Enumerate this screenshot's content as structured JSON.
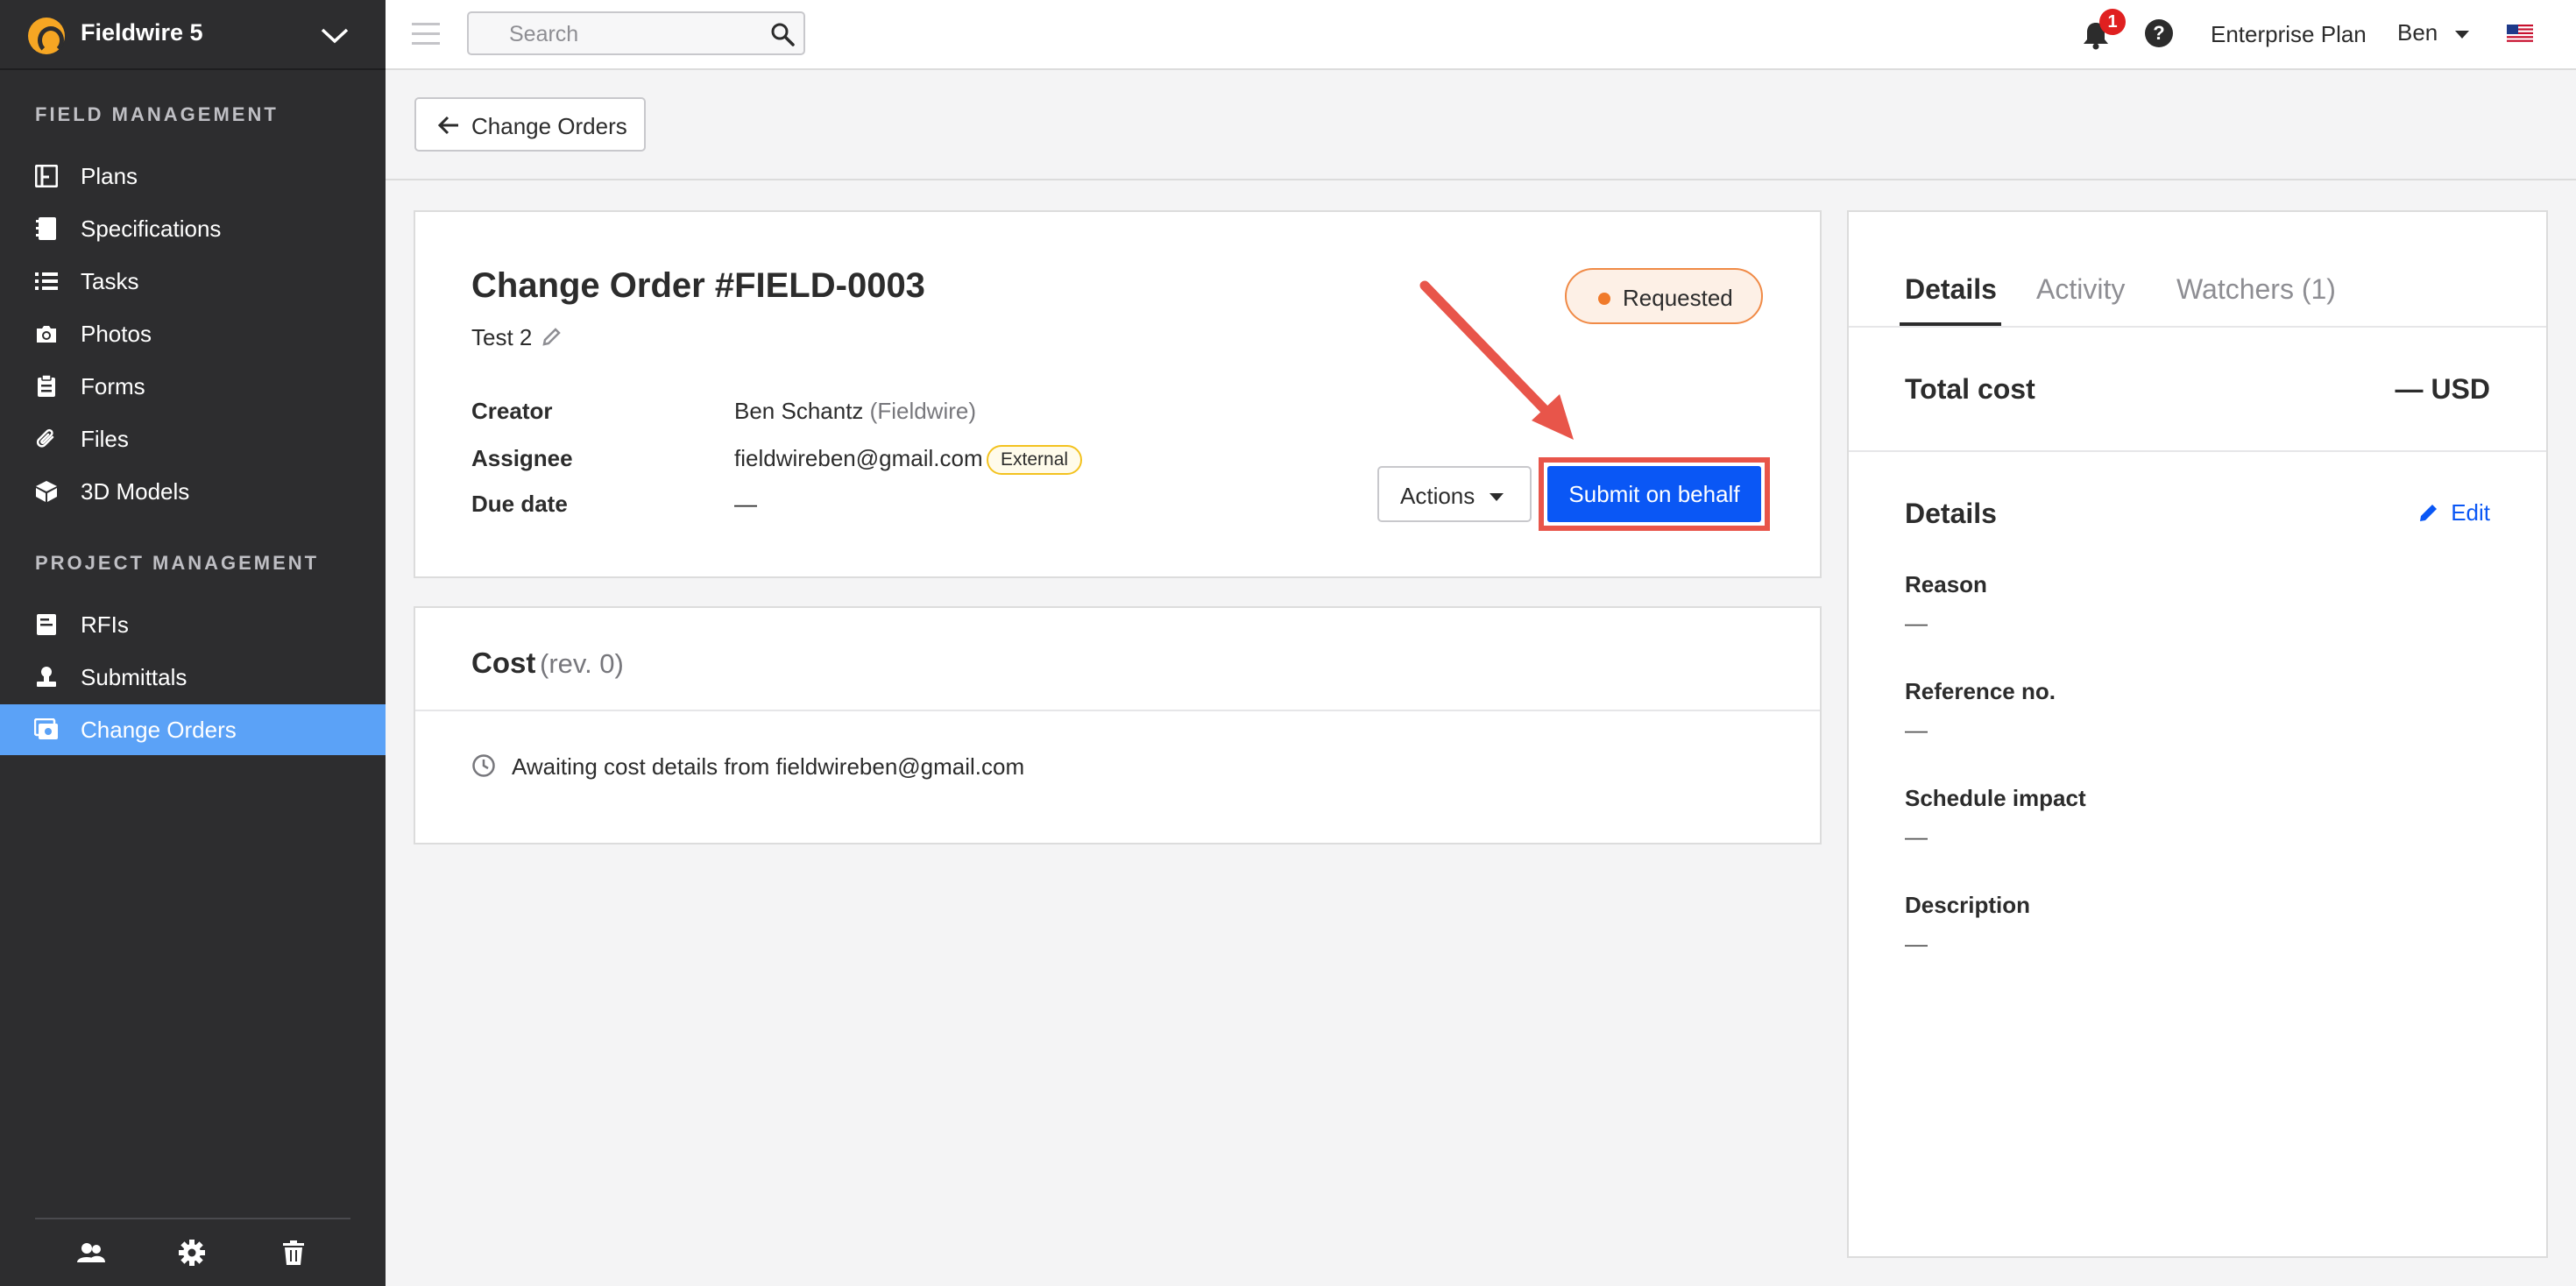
{
  "sidebar": {
    "project_name": "Fieldwire 5",
    "sections": [
      {
        "label": "FIELD MANAGEMENT",
        "items": [
          {
            "label": "Plans",
            "icon": "plans-icon"
          },
          {
            "label": "Specifications",
            "icon": "specifications-icon"
          },
          {
            "label": "Tasks",
            "icon": "tasks-icon"
          },
          {
            "label": "Photos",
            "icon": "camera-icon"
          },
          {
            "label": "Forms",
            "icon": "forms-icon"
          },
          {
            "label": "Files",
            "icon": "paperclip-icon"
          },
          {
            "label": "3D Models",
            "icon": "cube-icon"
          }
        ]
      },
      {
        "label": "PROJECT MANAGEMENT",
        "items": [
          {
            "label": "RFIs",
            "icon": "rfi-icon"
          },
          {
            "label": "Submittals",
            "icon": "submittals-icon"
          },
          {
            "label": "Change Orders",
            "icon": "change-orders-icon",
            "active": true
          }
        ]
      }
    ],
    "footer_icons": [
      "people-icon",
      "gear-icon",
      "trash-icon"
    ]
  },
  "topbar": {
    "search_placeholder": "Search",
    "notification_count": "1",
    "help_symbol": "?",
    "plan": "Enterprise Plan",
    "user": "Ben"
  },
  "subheader": {
    "back_label": "Change Orders"
  },
  "change_order": {
    "title": "Change Order #FIELD-0003",
    "subtitle": "Test 2",
    "status": "Requested",
    "fields": {
      "creator_label": "Creator",
      "creator_name": "Ben Schantz",
      "creator_org": "(Fieldwire)",
      "assignee_label": "Assignee",
      "assignee_email": "fieldwireben@gmail.com",
      "assignee_badge": "External",
      "due_label": "Due date",
      "due_value": "—"
    },
    "actions_label": "Actions",
    "submit_label": "Submit on behalf"
  },
  "cost": {
    "title": "Cost",
    "revision": "(rev. 0)",
    "message": "Awaiting cost details from fieldwireben@gmail.com"
  },
  "right_panel": {
    "tabs": [
      "Details",
      "Activity",
      "Watchers (1)"
    ],
    "total_cost_label": "Total cost",
    "total_cost_value": "— USD",
    "details_heading": "Details",
    "edit_label": "Edit",
    "details": [
      {
        "label": "Reason",
        "value": "—"
      },
      {
        "label": "Reference no.",
        "value": "—"
      },
      {
        "label": "Schedule impact",
        "value": "—"
      },
      {
        "label": "Description",
        "value": "—"
      }
    ]
  },
  "colors": {
    "sidebar_bg": "#2d2d2f",
    "active_nav": "#5ba2f7",
    "primary_button": "#0a57f5",
    "annotation_red": "#e8554a",
    "status_orange": "#f07a2a"
  }
}
